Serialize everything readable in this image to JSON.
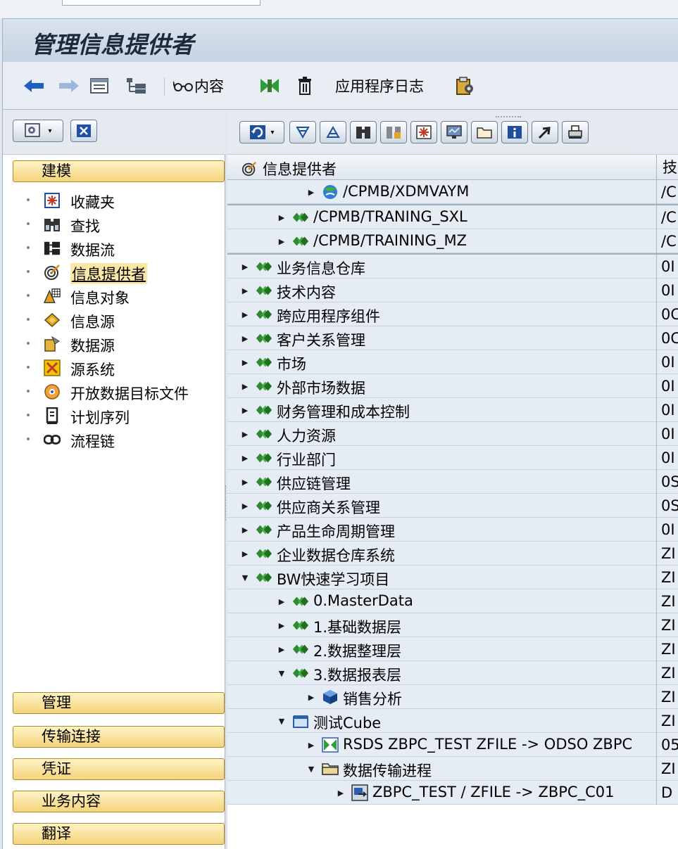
{
  "window": {
    "title": "管理信息提供者"
  },
  "appbar": {
    "content_label": "内容",
    "app_log_label": "应用程序日志"
  },
  "left": {
    "sections": {
      "modeling": "建模",
      "admin": "管理",
      "transport": "传输连接",
      "voucher": "凭证",
      "business_content": "业务内容",
      "translate": "翻译"
    },
    "items": [
      {
        "label": "收藏夹",
        "icon": "favorites-icon"
      },
      {
        "label": "查找",
        "icon": "binoculars-icon"
      },
      {
        "label": "数据流",
        "icon": "dataflow-icon"
      },
      {
        "label": "信息提供者",
        "icon": "target-icon",
        "selected": true
      },
      {
        "label": "信息对象",
        "icon": "infoobject-icon"
      },
      {
        "label": "信息源",
        "icon": "infosource-icon"
      },
      {
        "label": "数据源",
        "icon": "datasource-icon"
      },
      {
        "label": "源系统",
        "icon": "source-system-icon"
      },
      {
        "label": "开放数据目标文件",
        "icon": "open-hub-icon"
      },
      {
        "label": "计划序列",
        "icon": "process-variant-icon"
      },
      {
        "label": "流程链",
        "icon": "process-chain-icon"
      }
    ]
  },
  "tree": {
    "col1_header": "信息提供者",
    "col2_header": "技",
    "rows": [
      {
        "level": 3,
        "arrow": "right",
        "icon": "multiprovider-icon",
        "label": "/CPMB/XDMVAYM",
        "col2": "/C"
      },
      {
        "level": 2,
        "arrow": "right",
        "icon": "infoarea-icon",
        "label": "/CPMB/TRANING_SXL",
        "col2": "/C"
      },
      {
        "level": 2,
        "arrow": "right",
        "icon": "infoarea-icon",
        "label": "/CPMB/TRAINING_MZ",
        "col2": "/C"
      },
      {
        "level": 1,
        "arrow": "right",
        "icon": "infoarea-icon",
        "label": "业务信息仓库",
        "col2": "0I"
      },
      {
        "level": 1,
        "arrow": "right",
        "icon": "infoarea-icon",
        "label": "技术内容",
        "col2": "0I"
      },
      {
        "level": 1,
        "arrow": "right",
        "icon": "infoarea-icon",
        "label": "跨应用程序组件",
        "col2": "0C"
      },
      {
        "level": 1,
        "arrow": "right",
        "icon": "infoarea-icon",
        "label": "客户关系管理",
        "col2": "0C"
      },
      {
        "level": 1,
        "arrow": "right",
        "icon": "infoarea-icon",
        "label": "市场",
        "col2": "0I"
      },
      {
        "level": 1,
        "arrow": "right",
        "icon": "infoarea-icon",
        "label": "外部市场数据",
        "col2": "0I"
      },
      {
        "level": 1,
        "arrow": "right",
        "icon": "infoarea-icon",
        "label": "财务管理和成本控制",
        "col2": "0I"
      },
      {
        "level": 1,
        "arrow": "right",
        "icon": "infoarea-icon",
        "label": "人力资源",
        "col2": "0I"
      },
      {
        "level": 1,
        "arrow": "right",
        "icon": "infoarea-icon",
        "label": "行业部门",
        "col2": "0I"
      },
      {
        "level": 1,
        "arrow": "right",
        "icon": "infoarea-icon",
        "label": "供应链管理",
        "col2": "0S"
      },
      {
        "level": 1,
        "arrow": "right",
        "icon": "infoarea-icon",
        "label": "供应商关系管理",
        "col2": "0S"
      },
      {
        "level": 1,
        "arrow": "right",
        "icon": "infoarea-icon",
        "label": "产品生命周期管理",
        "col2": "0I"
      },
      {
        "level": 1,
        "arrow": "right",
        "icon": "infoarea-icon",
        "label": "企业数据仓库系统",
        "col2": "ZI"
      },
      {
        "level": 1,
        "arrow": "down",
        "icon": "infoarea-icon",
        "label": "BW快速学习项目",
        "col2": "ZI"
      },
      {
        "level": 2,
        "arrow": "right",
        "icon": "infoarea-icon",
        "label": "0.MasterData",
        "col2": "ZI"
      },
      {
        "level": 2,
        "arrow": "right",
        "icon": "infoarea-icon",
        "label": "1.基础数据层",
        "col2": "ZI"
      },
      {
        "level": 2,
        "arrow": "right",
        "icon": "infoarea-icon",
        "label": "2.数据整理层",
        "col2": "ZI"
      },
      {
        "level": 2,
        "arrow": "down",
        "icon": "infoarea-icon",
        "label": "3.数据报表层",
        "col2": "ZI"
      },
      {
        "level": 3,
        "arrow": "right",
        "icon": "infocube-icon",
        "label": "销售分析",
        "col2": "ZI"
      },
      {
        "level": 2,
        "arrow": "down",
        "icon": "cube-icon",
        "label": "测试Cube",
        "col2": "ZI"
      },
      {
        "level": 3,
        "arrow": "right",
        "icon": "transformation-icon",
        "label": "RSDS ZBPC_TEST ZFILE -> ODSO ZBPC",
        "col2": "05"
      },
      {
        "level": 3,
        "arrow": "down",
        "icon": "folder-icon",
        "label": "数据传输进程",
        "col2": "ZI"
      },
      {
        "level": 4,
        "arrow": "right",
        "icon": "dtp-icon",
        "label": "ZBPC_TEST / ZFILE -> ZBPC_C01",
        "col2": "D"
      }
    ]
  }
}
